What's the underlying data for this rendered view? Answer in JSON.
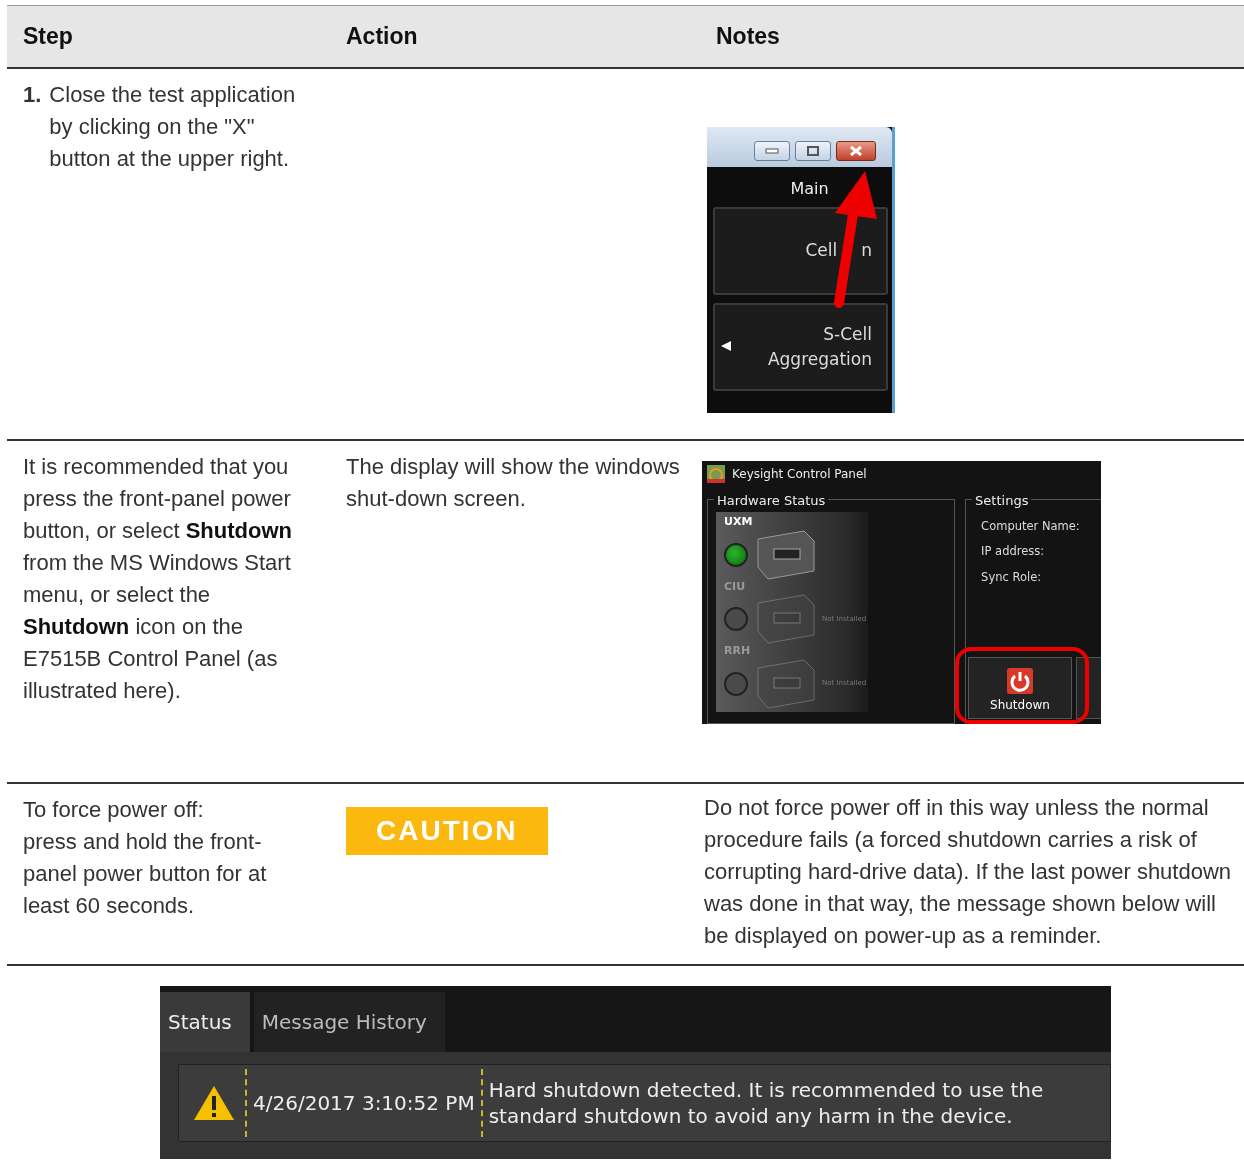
{
  "table": {
    "columns": [
      "Step",
      "Action",
      "Notes"
    ],
    "rows": [
      {
        "step": {
          "number": "1.",
          "text": "Close the test application by clicking on the \"X\" button at the upper right."
        },
        "notes": {
          "kind": "app-window",
          "title": "Main",
          "buttons": [
            {
              "label_parts": [
                "Cell",
                "n"
              ],
              "submenu": false
            },
            {
              "label_parts": [
                "S-Cell Aggregation"
              ],
              "submenu": true
            }
          ]
        }
      },
      {
        "step": {
          "text": "It is recommended that you press the front-panel power button, or select **Shutdown** from the MS Windows Start menu, or select the **Shutdown** icon on the E7515B Control Panel (as illustrated here)."
        },
        "action": {
          "kind": "text",
          "text": "The display will show the windows shut-down screen."
        },
        "notes": {
          "kind": "control-panel",
          "title": "Keysight Control Panel",
          "hardware": {
            "title": "Hardware Status",
            "devices": [
              {
                "name": "UXM",
                "installed": true
              },
              {
                "name": "CIU",
                "installed": false,
                "note": "Not Installed"
              },
              {
                "name": "RRH",
                "installed": false,
                "note": "Not Installed"
              }
            ]
          },
          "settings": {
            "title": "Settings",
            "fields": [
              "Computer Name:",
              "IP address:",
              "Sync Role:"
            ]
          },
          "shutdown": {
            "label": "Shutdown",
            "highlighted": true
          }
        }
      },
      {
        "step": {
          "lines": [
            "To force power off:",
            "press and hold the front-panel power button for at least 60 seconds."
          ]
        },
        "action": {
          "kind": "caution",
          "text": "CAUTION"
        },
        "notes": {
          "kind": "text",
          "text": "Do not force power off in this way unless the normal procedure fails (a forced shutdown carries a risk of corrupting hard-drive data). If the last power shutdown was done in that way, the message shown below will be displayed on power-up as a reminder."
        }
      }
    ]
  },
  "status_panel": {
    "tabs": [
      {
        "label": "Status",
        "selected": true
      },
      {
        "label": "Message History",
        "selected": false
      }
    ],
    "messages": [
      {
        "timestamp": "4/26/2017 3:10:52 PM",
        "text": "Hard shutdown detected. It is recommended to use the standard shutdown to avoid any harm in the device."
      }
    ]
  }
}
